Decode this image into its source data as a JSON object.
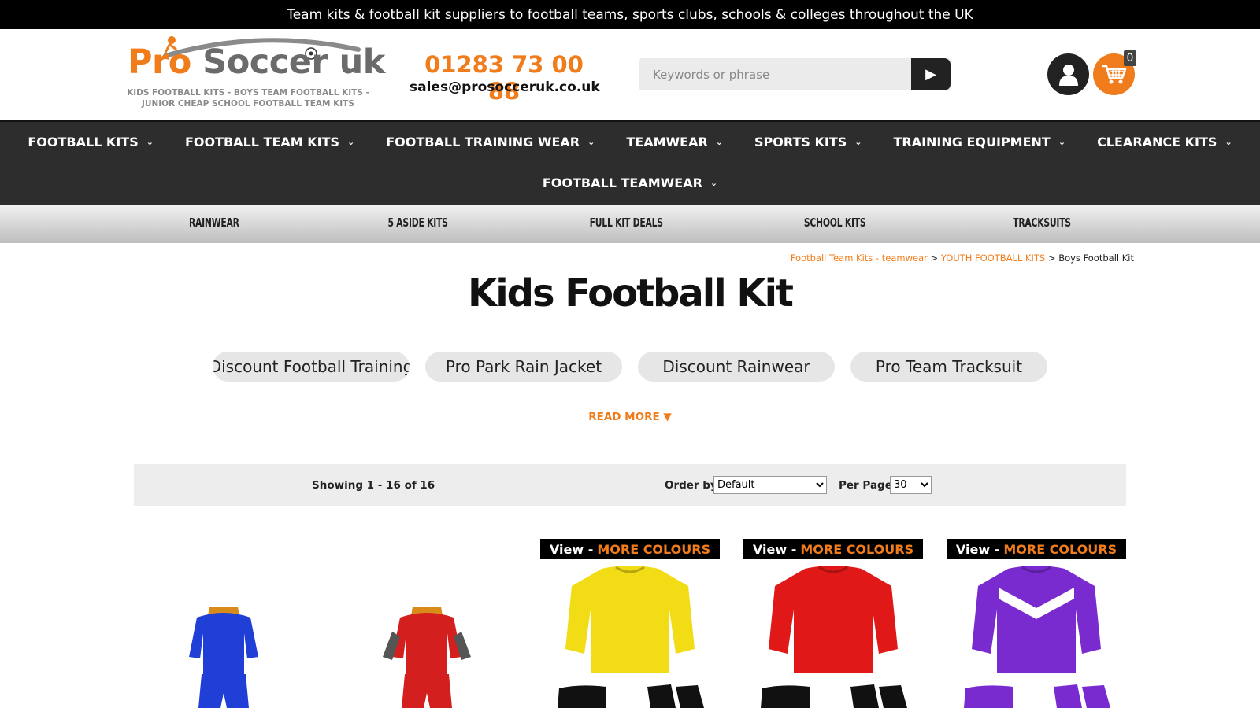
{
  "topbar": {
    "text": "Team kits & football kit suppliers to football teams, sports clubs, schools & colleges throughout the UK"
  },
  "header": {
    "logo": {
      "word1": "Pro",
      "word2": "Soccer uk",
      "tagline": "KIDS FOOTBALL KITS - BOYS TEAM FOOTBALL KITS - JUNIOR CHEAP SCHOOL FOOTBALL TEAM KITS"
    },
    "phone": "01283 73 00 88",
    "email": "sales@prosocceruk.co.uk",
    "search": {
      "placeholder": "Keywords or phrase",
      "button_icon": "play-arrow-icon"
    },
    "cart_count": "0",
    "colors": {
      "accent": "#f07c1b",
      "dark": "#222222"
    }
  },
  "main_nav": {
    "row1": [
      {
        "label": "FOOTBALL KITS"
      },
      {
        "label": "FOOTBALL TEAM KITS"
      },
      {
        "label": "FOOTBALL TRAINING WEAR"
      },
      {
        "label": "TEAMWEAR"
      },
      {
        "label": "SPORTS KITS"
      },
      {
        "label": "TRAINING EQUIPMENT"
      },
      {
        "label": "CLEARANCE KITS"
      }
    ],
    "row2": [
      {
        "label": "FOOTBALL TEAMWEAR"
      }
    ]
  },
  "sub_nav": [
    {
      "label": "RAINWEAR"
    },
    {
      "label": "5 ASIDE KITS"
    },
    {
      "label": "FULL KIT DEALS"
    },
    {
      "label": "SCHOOL KITS"
    },
    {
      "label": "TRACKSUITS"
    }
  ],
  "breadcrumb": {
    "crumb1": "Football Team Kits - teamwear",
    "sep": ">",
    "crumb2": "YOUTH FOOTBALL KITS",
    "current": "Boys Football Kit"
  },
  "page_title": "Kids Football Kit",
  "category_pills": [
    {
      "label": "Discount Football Training"
    },
    {
      "label": "Pro Park Rain Jacket"
    },
    {
      "label": "Discount Rainwear"
    },
    {
      "label": "Pro Team Tracksuit"
    }
  ],
  "read_more": {
    "label": "READ MORE",
    "arrow": "▼"
  },
  "listing_toolbar": {
    "showing": "Showing 1 - 16 of 16",
    "order_by_label": "Order by",
    "order_by_value": "Default",
    "per_page_label": "Per Page",
    "per_page_value": "30"
  },
  "products": [
    {
      "shirt_color": "#1f3fd6",
      "has_banner": false
    },
    {
      "shirt_color": "#d41f1f",
      "has_banner": false
    },
    {
      "shirt_color": "#f2dc16",
      "has_banner": true,
      "banner_view": "View -",
      "banner_more": "MORE COLOURS"
    },
    {
      "shirt_color": "#e01818",
      "has_banner": true,
      "banner_view": "View -",
      "banner_more": "MORE COLOURS"
    },
    {
      "shirt_color": "#7a2bd0",
      "has_banner": true,
      "banner_view": "View -",
      "banner_more": "MORE COLOURS"
    }
  ]
}
